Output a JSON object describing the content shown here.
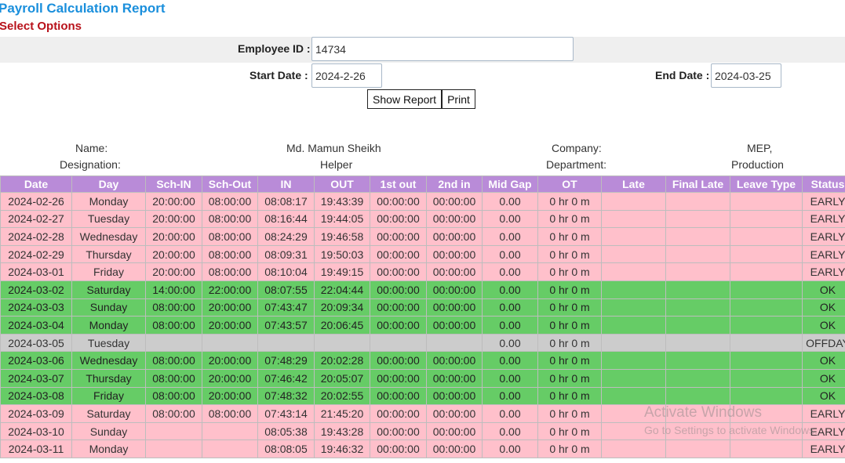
{
  "header": {
    "title": "Payroll Calculation Report",
    "subtitle": "Select Options"
  },
  "form": {
    "employee_id_label": "Employee ID :",
    "employee_id_value": "14734",
    "start_date_label": "Start Date :",
    "start_date_value": "2024-2-26",
    "end_date_label": "End Date :",
    "end_date_value": "2024-03-25",
    "show_report_label": "Show Report",
    "print_label": "Print"
  },
  "employee": {
    "name_label": "Name:",
    "name_value": "Md. Mamun Sheikh",
    "company_label": "Company:",
    "company_value": "MEP,",
    "designation_label": "Designation:",
    "designation_value": "Helper",
    "department_label": "Department:",
    "department_value": "Production"
  },
  "table": {
    "columns": [
      "Date",
      "Day",
      "Sch-IN",
      "Sch-Out",
      "IN",
      "OUT",
      "1st out",
      "2nd in",
      "Mid Gap",
      "OT",
      "Late",
      "Final Late",
      "Leave Type",
      "Status"
    ],
    "rows": [
      {
        "status_class": "early",
        "cells": [
          "2024-02-26",
          "Monday",
          "20:00:00",
          "08:00:00",
          "08:08:17",
          "19:43:39",
          "00:00:00",
          "00:00:00",
          "0.00",
          "0 hr 0 m",
          "",
          "",
          "",
          "EARLY"
        ]
      },
      {
        "status_class": "early",
        "cells": [
          "2024-02-27",
          "Tuesday",
          "20:00:00",
          "08:00:00",
          "08:16:44",
          "19:44:05",
          "00:00:00",
          "00:00:00",
          "0.00",
          "0 hr 0 m",
          "",
          "",
          "",
          "EARLY"
        ]
      },
      {
        "status_class": "early",
        "cells": [
          "2024-02-28",
          "Wednesday",
          "20:00:00",
          "08:00:00",
          "08:24:29",
          "19:46:58",
          "00:00:00",
          "00:00:00",
          "0.00",
          "0 hr 0 m",
          "",
          "",
          "",
          "EARLY"
        ]
      },
      {
        "status_class": "early",
        "cells": [
          "2024-02-29",
          "Thursday",
          "20:00:00",
          "08:00:00",
          "08:09:31",
          "19:50:03",
          "00:00:00",
          "00:00:00",
          "0.00",
          "0 hr 0 m",
          "",
          "",
          "",
          "EARLY"
        ]
      },
      {
        "status_class": "early",
        "cells": [
          "2024-03-01",
          "Friday",
          "20:00:00",
          "08:00:00",
          "08:10:04",
          "19:49:15",
          "00:00:00",
          "00:00:00",
          "0.00",
          "0 hr 0 m",
          "",
          "",
          "",
          "EARLY"
        ]
      },
      {
        "status_class": "ok",
        "cells": [
          "2024-03-02",
          "Saturday",
          "14:00:00",
          "22:00:00",
          "08:07:55",
          "22:04:44",
          "00:00:00",
          "00:00:00",
          "0.00",
          "0 hr 0 m",
          "",
          "",
          "",
          "OK"
        ]
      },
      {
        "status_class": "ok",
        "cells": [
          "2024-03-03",
          "Sunday",
          "08:00:00",
          "20:00:00",
          "07:43:47",
          "20:09:34",
          "00:00:00",
          "00:00:00",
          "0.00",
          "0 hr 0 m",
          "",
          "",
          "",
          "OK"
        ]
      },
      {
        "status_class": "ok",
        "cells": [
          "2024-03-04",
          "Monday",
          "08:00:00",
          "20:00:00",
          "07:43:57",
          "20:06:45",
          "00:00:00",
          "00:00:00",
          "0.00",
          "0 hr 0 m",
          "",
          "",
          "",
          "OK"
        ]
      },
      {
        "status_class": "off",
        "cells": [
          "2024-03-05",
          "Tuesday",
          "",
          "",
          "",
          "",
          "",
          "",
          "0.00",
          "0 hr 0 m",
          "",
          "",
          "",
          "OFFDAY"
        ]
      },
      {
        "status_class": "ok",
        "cells": [
          "2024-03-06",
          "Wednesday",
          "08:00:00",
          "20:00:00",
          "07:48:29",
          "20:02:28",
          "00:00:00",
          "00:00:00",
          "0.00",
          "0 hr 0 m",
          "",
          "",
          "",
          "OK"
        ]
      },
      {
        "status_class": "ok",
        "cells": [
          "2024-03-07",
          "Thursday",
          "08:00:00",
          "20:00:00",
          "07:46:42",
          "20:05:07",
          "00:00:00",
          "00:00:00",
          "0.00",
          "0 hr 0 m",
          "",
          "",
          "",
          "OK"
        ]
      },
      {
        "status_class": "ok",
        "cells": [
          "2024-03-08",
          "Friday",
          "08:00:00",
          "20:00:00",
          "07:48:32",
          "20:02:55",
          "00:00:00",
          "00:00:00",
          "0.00",
          "0 hr 0 m",
          "",
          "",
          "",
          "OK"
        ]
      },
      {
        "status_class": "early",
        "cells": [
          "2024-03-09",
          "Saturday",
          "08:00:00",
          "08:00:00",
          "07:43:14",
          "21:45:20",
          "00:00:00",
          "00:00:00",
          "0.00",
          "0 hr 0 m",
          "",
          "",
          "",
          "EARLY"
        ]
      },
      {
        "status_class": "early",
        "cells": [
          "2024-03-10",
          "Sunday",
          "",
          "",
          "08:05:38",
          "19:43:28",
          "00:00:00",
          "00:00:00",
          "0.00",
          "0 hr 0 m",
          "",
          "",
          "",
          "EARLY"
        ]
      },
      {
        "status_class": "early",
        "cells": [
          "2024-03-11",
          "Monday",
          "",
          "",
          "08:08:05",
          "19:46:32",
          "00:00:00",
          "00:00:00",
          "0.00",
          "0 hr 0 m",
          "",
          "",
          "",
          "EARLY"
        ]
      }
    ]
  },
  "watermark": {
    "line1": "Activate Windows",
    "line2": "Go to Settings to activate Windows."
  }
}
